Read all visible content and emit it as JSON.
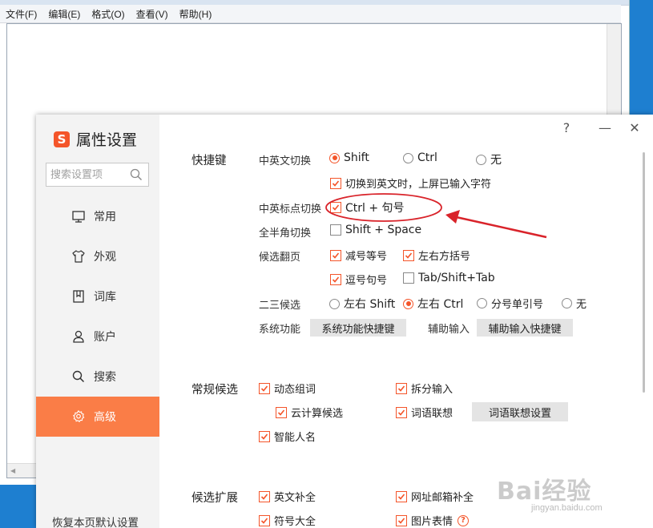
{
  "notepad": {
    "menu": [
      "文件(F)",
      "编辑(E)",
      "格式(O)",
      "查看(V)",
      "帮助(H)"
    ]
  },
  "dialog": {
    "title": "属性设置",
    "logo_char": "S",
    "search_placeholder": "搜索设置项",
    "nav": [
      {
        "label": "常用",
        "icon": "monitor-icon"
      },
      {
        "label": "外观",
        "icon": "shirt-icon"
      },
      {
        "label": "词库",
        "icon": "book-icon"
      },
      {
        "label": "账户",
        "icon": "user-icon"
      },
      {
        "label": "搜索",
        "icon": "search-icon"
      },
      {
        "label": "高级",
        "icon": "gear-icon",
        "active": true
      }
    ],
    "restore": "恢复本页默认设置",
    "controls": {
      "help": "?",
      "minimize": "—",
      "close": "✕"
    }
  },
  "shortcuts": {
    "title": "快捷键",
    "cn_en_switch": {
      "label": "中英文切换",
      "options": [
        "Shift",
        "Ctrl",
        "无"
      ],
      "selected": "Shift",
      "commit_on_switch": {
        "label": "切换到英文时，上屏已输入字符",
        "checked": true
      }
    },
    "punct_switch": {
      "label": "中英标点切换",
      "option": "Ctrl + 句号",
      "checked": true
    },
    "width_switch": {
      "label": "全半角切换",
      "option": "Shift + Space",
      "checked": false
    },
    "page_flip": {
      "label": "候选翻页",
      "options": [
        {
          "label": "减号等号",
          "checked": true
        },
        {
          "label": "左右方括号",
          "checked": true
        },
        {
          "label": "逗号句号",
          "checked": true
        },
        {
          "label": "Tab/Shift+Tab",
          "checked": false
        }
      ]
    },
    "second_third": {
      "label": "二三候选",
      "options": [
        "左右 Shift",
        "左右 Ctrl",
        "分号单引号",
        "无"
      ],
      "selected": "左右 Ctrl"
    },
    "system_func": {
      "label": "系统功能",
      "button": "系统功能快捷键"
    },
    "assist_input": {
      "label": "辅助输入",
      "button": "辅助输入快捷键"
    }
  },
  "regular_candidates": {
    "title": "常规候选",
    "options": [
      {
        "label": "动态组词",
        "checked": true
      },
      {
        "label": "拆分输入",
        "checked": true
      },
      {
        "label": "云计算候选",
        "checked": true
      },
      {
        "label": "词语联想",
        "checked": true
      },
      {
        "label": "智能人名",
        "checked": true
      }
    ],
    "assoc_button": "词语联想设置"
  },
  "candidate_ext": {
    "title": "候选扩展",
    "options": [
      {
        "label": "英文补全",
        "checked": true
      },
      {
        "label": "网址邮箱补全",
        "checked": true
      },
      {
        "label": "符号大全",
        "checked": true
      },
      {
        "label": "图片表情",
        "checked": true
      }
    ],
    "help_icon": "?"
  },
  "annotation": {
    "color": "#d9232a"
  },
  "watermark": {
    "text": "Bai经验",
    "url": "jingyan.baidu.com"
  }
}
